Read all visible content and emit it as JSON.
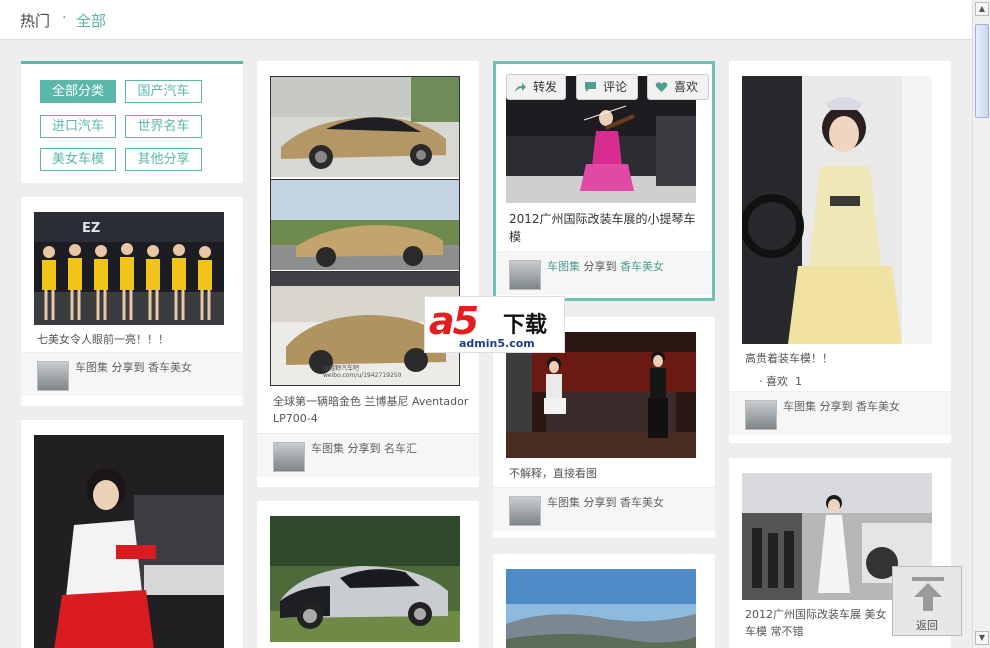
{
  "header": {
    "hot": "热门",
    "sep": "·",
    "all": "全部"
  },
  "categories": [
    "全部分类",
    "国产汽车",
    "进口汽车",
    "世界名车",
    "美女车模",
    "其他分享"
  ],
  "share_verb": "分享到",
  "overlay": {
    "forward": "转发",
    "comment": "评论",
    "like": "喜欢"
  },
  "cards": {
    "c1": {
      "caption": "七美女令人眼前一亮！！！",
      "user": "车图集",
      "board": "香车美女"
    },
    "c3": {
      "caption": "全球第一辆暗金色 兰博基尼 Aventador LP700-4",
      "user": "车图集",
      "board": "名车汇",
      "photo_credit": "@越野汽车吧\nweibo.com/u/1942719250"
    },
    "c5": {
      "caption": "2012广州国际改装车展的小提琴车模",
      "user": "车图集",
      "board": "香车美女"
    },
    "c6": {
      "caption": "不解释，直接看图",
      "user": "车图集",
      "board": "香车美女"
    },
    "c8": {
      "caption": "高贵着装车模！！",
      "likes_label": "喜欢",
      "likes": "1",
      "user": "车图集",
      "board": "香车美女"
    },
    "c9": {
      "caption": "2012广州国际改装车展 美女车模 常不错"
    }
  },
  "watermark": {
    "brand": "a5",
    "download": "下载",
    "site": "admin5.com"
  },
  "back": "返回",
  "colors": {
    "accent": "#5cb7ab",
    "background": "#efeeee"
  }
}
